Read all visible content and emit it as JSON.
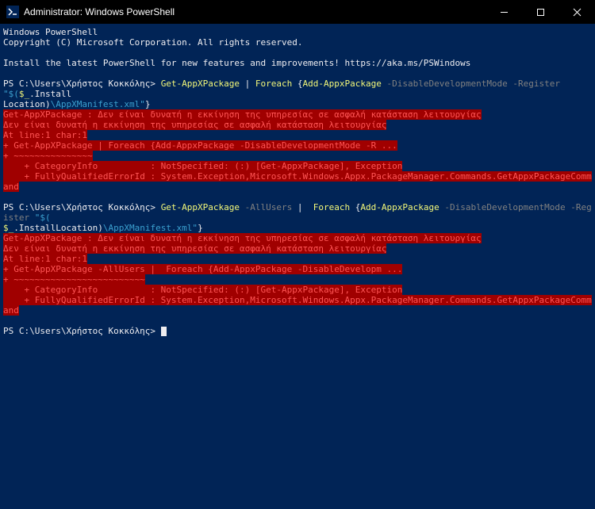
{
  "titlebar": {
    "title": "Administrator: Windows PowerShell"
  },
  "terminal": {
    "header1": "Windows PowerShell",
    "header2": "Copyright (C) Microsoft Corporation. All rights reserved.",
    "installMsg": "Install the latest PowerShell for new features and improvements! https://aka.ms/PSWindows",
    "prompt1": "PS C:\\Users\\Χρήστος Κοκκόλης> ",
    "cmd1_a": "Get-AppXPackage ",
    "cmd1_pipe": "| ",
    "cmd1_b": "Foreach ",
    "cmd1_c": "{",
    "cmd1_d": "Add-AppxPackage ",
    "cmd1_e": "-DisableDevelopmentMode -Register ",
    "cmd1_f": "\"$(",
    "cmd1_g": "$_",
    "cmd1_h": ".Install",
    "cmd1_loc": "Location)",
    "cmd1_manifest": "\\AppXManifest.xml\"",
    "cmd1_end": "}",
    "err1_a": "Get-AppXPackage : Δεν είναι δυνατή η εκκίνηση της υπηρεσίας σε ασφαλή κατάσταση λειτουργίας",
    "err1_b": "Δεν είναι δυνατή η εκκίνηση της υπηρεσίας σε ασφαλή κατάσταση λειτουργίας",
    "err1_c": "At line:1 char:1",
    "err1_d": "+ Get-AppXPackage | Foreach {Add-AppxPackage -DisableDevelopmentMode -R ...",
    "err1_e": "+ ~~~~~~~~~~~~~~~",
    "err1_f": "    + CategoryInfo          : NotSpecified: (:) [Get-AppxPackage], Exception",
    "err1_g": "    + FullyQualifiedErrorId : System.Exception,Microsoft.Windows.Appx.PackageManager.Commands.GetAppxPackageCommand",
    "prompt2": "PS C:\\Users\\Χρήστος Κοκκόλης> ",
    "cmd2_a": "Get-AppXPackage ",
    "cmd2_allusers": "-AllUsers ",
    "cmd2_pipe": "| ",
    "cmd2_b": " Foreach ",
    "cmd2_c": "{",
    "cmd2_d": "Add-AppxPackage ",
    "cmd2_e": "-DisableDevelopmentMode -Register ",
    "cmd2_f": "\"$(",
    "cmd2_g": "$_",
    "cmd2_h": ".InstallLocation)",
    "cmd2_manifest": "\\AppXManifest.xml\"",
    "cmd2_end": "}",
    "err2_a": "Get-AppXPackage : Δεν είναι δυνατή η εκκίνηση της υπηρεσίας σε ασφαλή κατάσταση λειτουργίας",
    "err2_b": "Δεν είναι δυνατή η εκκίνηση της υπηρεσίας σε ασφαλή κατάσταση λειτουργίας",
    "err2_c": "At line:1 char:1",
    "err2_d": "+ Get-AppXPackage -AllUsers |  Foreach {Add-AppxPackage -DisableDevelopm ...",
    "err2_e": "+ ~~~~~~~~~~~~~~~~~~~~~~~~~",
    "err2_f": "    + CategoryInfo          : NotSpecified: (:) [Get-AppxPackage], Exception",
    "err2_g": "    + FullyQualifiedErrorId : System.Exception,Microsoft.Windows.Appx.PackageManager.Commands.GetAppxPackageCommand",
    "prompt3": "PS C:\\Users\\Χρήστος Κοκκόλης> "
  }
}
